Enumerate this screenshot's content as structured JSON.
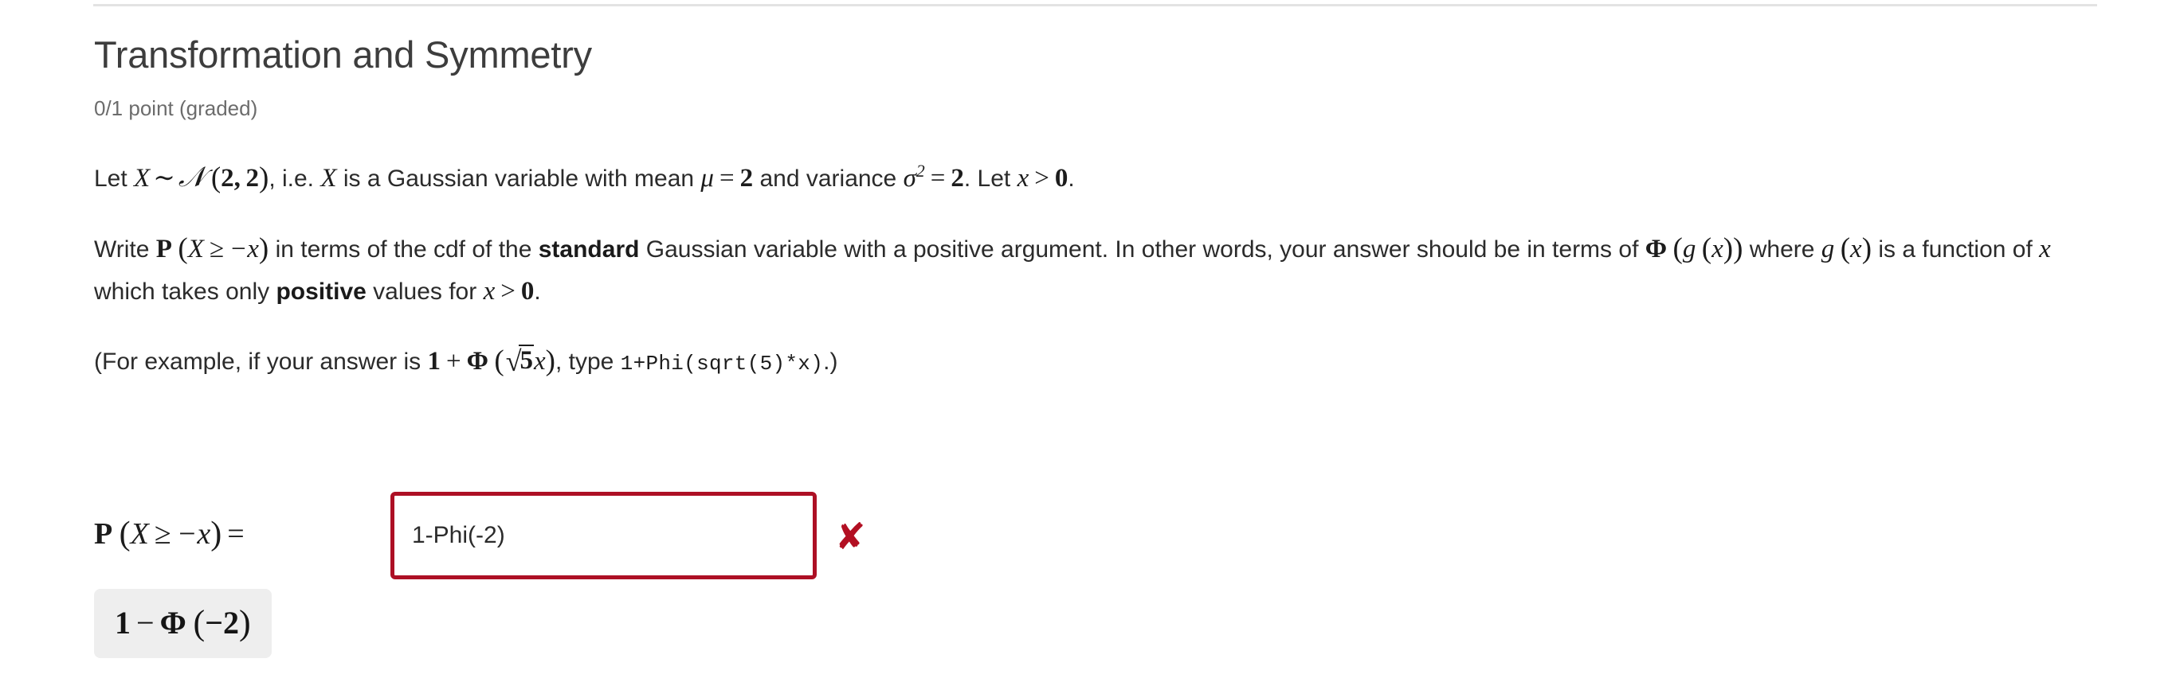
{
  "problem": {
    "title": "Transformation and Symmetry",
    "points_status": "0/1 point (graded)"
  },
  "statement": {
    "p1": {
      "lead": "Let ",
      "math_dist": "X ∼ 𝒩 (2, 2)",
      "after_dist": ", i.e. ",
      "math_var": "X",
      "mid": " is a Gaussian variable with mean ",
      "math_mean": "μ = 2",
      "and": " and variance ",
      "math_var_sigma": "σ² = 2",
      "tail": ". Let ",
      "math_xpos": "x > 0",
      "end": "."
    },
    "p2": {
      "write": "Write ",
      "math_prob": "P (X ≥ −x)",
      "terms": " in terms of the cdf of the ",
      "bold_standard": "standard",
      "gauss": " Gaussian variable with a positive argument. In other words, your answer should be in terms of ",
      "math_phi_g": "Φ (g (x))",
      "where": " where ",
      "math_g": "g (x)",
      "is_fn": " is a function of ",
      "math_x": "x",
      "which_takes": " which takes only ",
      "bold_positive": "positive",
      "values_for": " values for ",
      "math_xpos2": "x > 0",
      "end": "."
    },
    "p3": {
      "open": "(For example, if your answer is ",
      "math_example": "1 + Φ (√5x)",
      "type": ", type ",
      "code_example": "1+Phi(sqrt(5)*x)",
      "close": ".)"
    }
  },
  "answer": {
    "label": "P (X ≥ −x) =",
    "value": "1-Phi(-2)",
    "placeholder": "",
    "correctness_icon": "✘",
    "correctness_icon_name": "incorrect-x-icon",
    "rendered_preview": "1 − Φ (−2)"
  },
  "colors": {
    "title": "#3d3d3d",
    "body_text": "#2b2b2b",
    "muted_text": "#6c6c6c",
    "incorrect_red": "#ad1025",
    "preview_bg": "#eeeeee",
    "rule": "#e3e3e3"
  }
}
